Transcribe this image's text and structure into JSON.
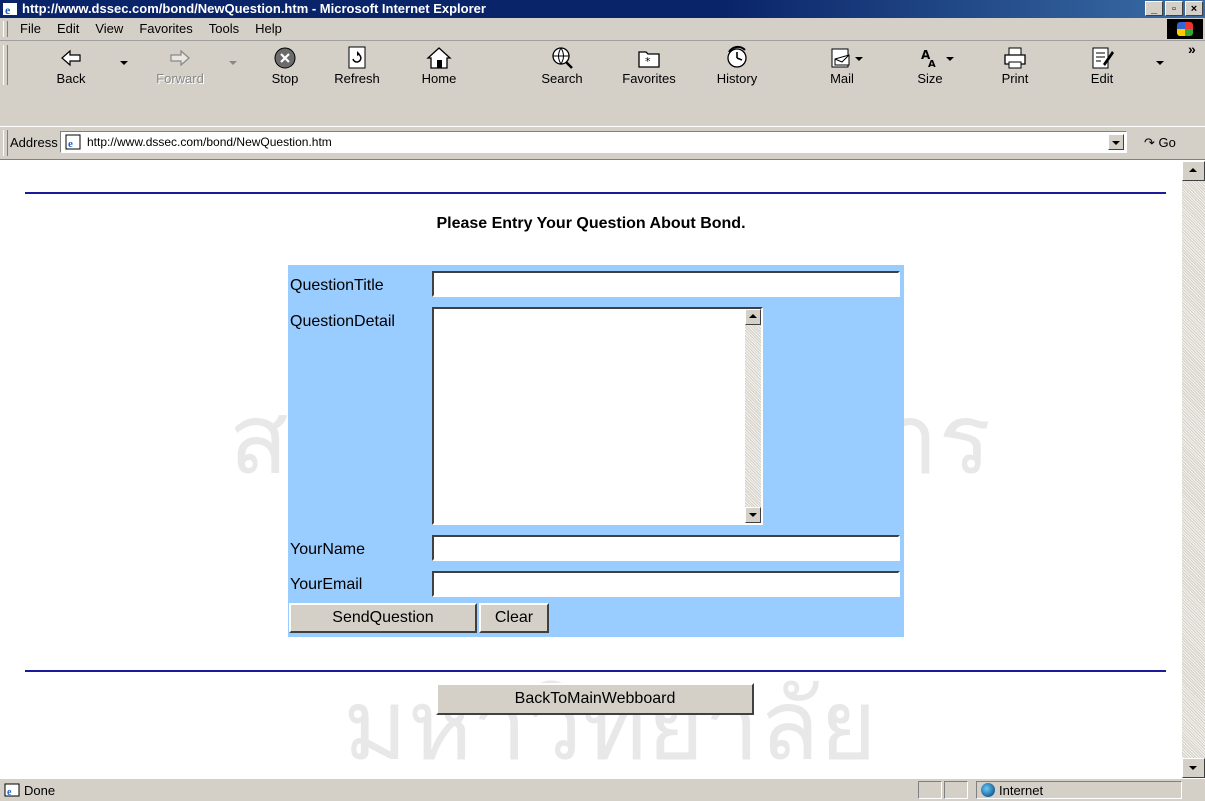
{
  "window": {
    "title": "http://www.dssec.com/bond/NewQuestion.htm - Microsoft Internet Explorer",
    "buttons": [
      "_",
      "▫",
      "×"
    ]
  },
  "menu": [
    "File",
    "Edit",
    "View",
    "Favorites",
    "Tools",
    "Help"
  ],
  "toolbar": {
    "back": "Back",
    "forward": "Forward",
    "stop": "Stop",
    "refresh": "Refresh",
    "home": "Home",
    "search": "Search",
    "favorites": "Favorites",
    "history": "History",
    "mail": "Mail",
    "size": "Size",
    "print": "Print",
    "edit": "Edit",
    "more": "»"
  },
  "address": {
    "label": "Address",
    "url": "http://www.dssec.com/bond/NewQuestion.htm",
    "go": "Go"
  },
  "page": {
    "heading": "Please Entry Your Question About Bond.",
    "form": {
      "question_title_label": "QuestionTitle",
      "question_detail_label": "QuestionDetail",
      "your_name_label": "YourName",
      "your_email_label": "YourEmail",
      "question_title_value": "",
      "your_name_value": "",
      "your_email_value": "",
      "send_button": "SendQuestion",
      "clear_button": "Clear"
    },
    "back_button": "BackToMainWebboard",
    "watermark_line1": "สถาบันวิทยบริการ",
    "watermark_line2": "จุฬาลงกรณ์มหาวิทยาลัย"
  },
  "status": {
    "text": "Done",
    "zone": "Internet"
  },
  "colors": {
    "form_background": "#99ccff",
    "rule": "#1a1a9a",
    "chrome": "#d4d0c8"
  }
}
